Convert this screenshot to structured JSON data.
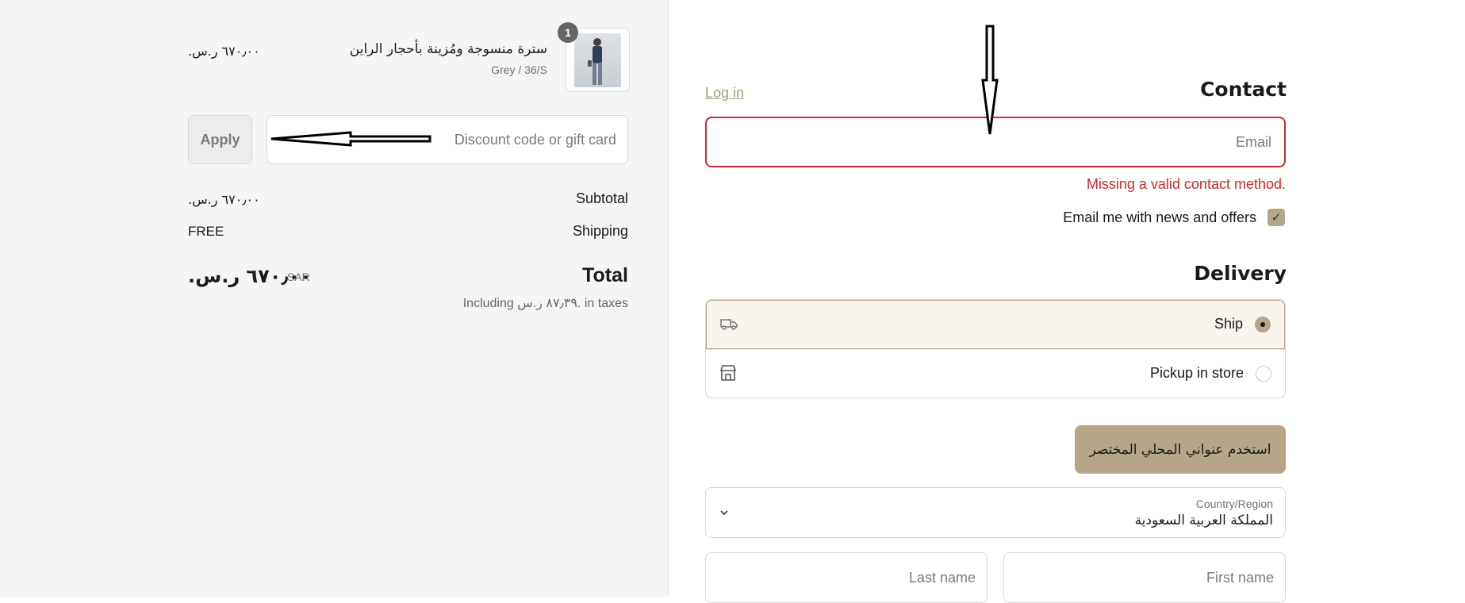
{
  "summary": {
    "item": {
      "quantity": "1",
      "name": "سترة منسوجة ومُزينة بأحجار الراين",
      "variant": "Grey / 36/S",
      "price": "٦٧٠٫٠٠ ر.س."
    },
    "discount": {
      "placeholder": "Discount code or gift card",
      "apply_label": "Apply"
    },
    "subtotal": {
      "label": "Subtotal",
      "value": "٦٧٠٫٠٠ ر.س."
    },
    "shipping": {
      "label": "Shipping",
      "value": "FREE"
    },
    "total": {
      "label": "Total",
      "currency": "SAR",
      "value": "٦٧٠٫٠٠ ر.س.",
      "taxes_note": "Including ٨٧٫٣٩ ر.س. in taxes"
    }
  },
  "contact": {
    "heading": "Contact",
    "login_link": "Log in",
    "email_placeholder": "Email",
    "error": "Missing a valid contact method.",
    "newsletter_label": "Email me with news and offers",
    "newsletter_checked": true
  },
  "delivery": {
    "heading": "Delivery",
    "options": [
      {
        "label": "Ship",
        "selected": true,
        "icon": "truck-icon"
      },
      {
        "label": "Pickup in store",
        "selected": false,
        "icon": "store-icon"
      }
    ],
    "local_address_button": "استخدم عنواني المحلي المختصر",
    "country": {
      "caption": "Country/Region",
      "value": "المملكة العربية السعودية"
    },
    "first_name_placeholder": "First name",
    "last_name_placeholder": "Last name"
  },
  "colors": {
    "accent": "#b5a68a",
    "error": "#c62b30",
    "summary_bg": "#f5f5f5"
  }
}
